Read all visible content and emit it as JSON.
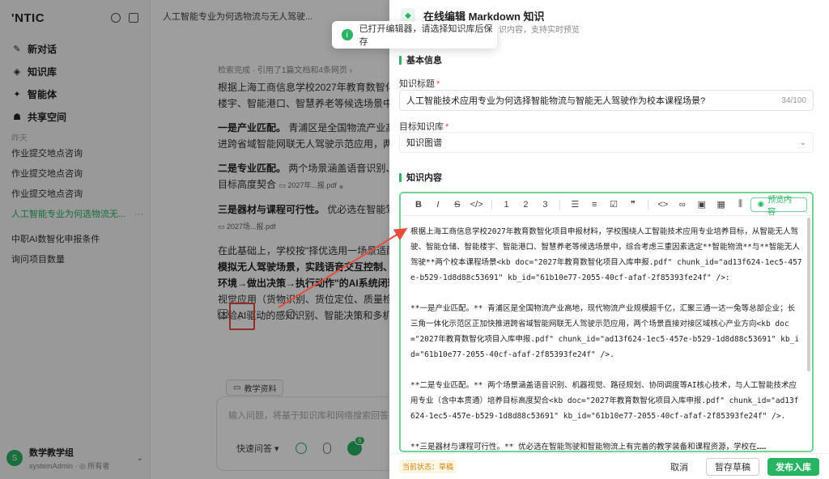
{
  "sidebar": {
    "brand": "'NTIC",
    "nav": [
      {
        "label": "新对话",
        "icon": "edit-icon"
      },
      {
        "label": "知识库",
        "icon": "cube-icon"
      },
      {
        "label": "智能体",
        "icon": "sparkle-icon"
      },
      {
        "label": "共享空间",
        "icon": "people-icon"
      }
    ],
    "history_title": "昨天",
    "history": [
      "作业提交地点咨询",
      "作业提交地点咨询",
      "作业提交地点咨询",
      "人工智能专业为何选物流无...",
      "中职AI数智化申报条件",
      "询问项目数量"
    ],
    "active_index": 3,
    "user": {
      "avatar": "S",
      "name": "数学教学组",
      "role": "systemAdmin · ◎ 所有者"
    }
  },
  "chat": {
    "title": "人工智能专业为何选物流与无人驾驶...",
    "meta": "检索完成 · 引用了1篇文档和4条网页 ›",
    "p1": "根据上海工商信息学校2027年教育数智化...",
    "p1b": "楼宇、智能港口、智慧养老等候选场景中，",
    "p2_bold": "一是产业匹配。",
    "p2": " 青浦区是全国物流产业高...",
    "p2b": "进跨省域智能网联无人驾驶示范应用，两个...",
    "p3_bold": "二是专业匹配。",
    "p3": " 两个场景涵盖语音识别、...",
    "p3b": "目标高度契合",
    "p3_ref": "2027年...报.pdf",
    "p4_bold": "三是器材与课程可行性。",
    "p4": " 优必选在智能驾...",
    "p4_ref": "2027场...报.pdf",
    "p5": "在此基础上，学校按\"择优选用一场景适配...",
    "p5b_bold": "模拟无人驾驶场景，实践语音交互控制、",
    "p5c_bold": "环境→做出决策→执行动作\"的AI系统闭环；",
    "p5d": "视觉应用（货物识别、货位定位、质量检测...",
    "p5e": "体验AI驱动的感知识别、智能决策和多机协...",
    "kb_chip": "教学资料",
    "input_placeholder": "输入问题，将基于知识库和网络搜索回答",
    "quick_qa": "快速问答",
    "badge": "6"
  },
  "toast": {
    "text": "已打开编辑器，请选择知识库后保存"
  },
  "drawer": {
    "title": "在线编辑 Markdown 知识",
    "subtitle": "识内容，支持实时预览",
    "section_basic": "基本信息",
    "label_title": "知识标题",
    "title_value": "人工智能技术应用专业为何选择智能物流与智能无人驾驶作为校本课程场景?",
    "title_count": "34/100",
    "label_kb": "目标知识库",
    "kb_value": "知识图谱",
    "section_content": "知识内容",
    "preview_label": "预览内容",
    "editor_paragraphs": [
      "根据上海工商信息学校2027年教育数智化项目申报材料，学校围绕人工智能技术应用专业培养目标，从智能无人驾驶、智能仓储、智能楼宇、智能港口、智慧养老等候选场景中，综合考虑三重因素选定**智能物流**与**智能无人驾驶**两个校本课程场景<kb doc=\"2027年教育数智化项目入库申报.pdf\" chunk_id=\"ad13f624-1ec5-457e-b529-1d8d88c53691\" kb_id=\"61b10e77-2055-40cf-afaf-2f85393fe24f\" />:",
      "**一是产业匹配。** 青浦区是全国物流产业高地，现代物流产业规模超千亿，汇聚三通一达一兔等总部企业；长三角一体化示范区正加快推进跨省域智能网联无人驾驶示范应用，两个场景直接对接区域核心产业方向<kb doc=\"2027年教育数智化项目入库申报.pdf\" chunk_id=\"ad13f624-1ec5-457e-b529-1d8d88c53691\" kb_id=\"61b10e77-2055-40cf-afaf-2f85393fe24f\" />.",
      "**二是专业匹配。** 两个场景涵盖语音识别、机器视觉、路径规划、协同调度等AI核心技术，与人工智能技术应用专业（含中本贯通）培养目标高度契合<kb doc=\"2027年教育数智化项目入库申报.pdf\" chunk_id=\"ad13f624-1ec5-457e-b529-1d8d88c53691\" kb_id=\"61b10e77-2055-40cf-afaf-2f85393fe24f\" />.",
      "**三是器材与课程可行性。** 优必选在智能驾驶和智能物流上有完善的教学装备和课程资源，学校在……"
    ],
    "status": "当前状态：草稿",
    "cancel": "取消",
    "save_draft": "暂存草稿",
    "publish": "发布入库"
  },
  "colors": {
    "accent": "#28b463",
    "annotation": "#e74c3c"
  }
}
